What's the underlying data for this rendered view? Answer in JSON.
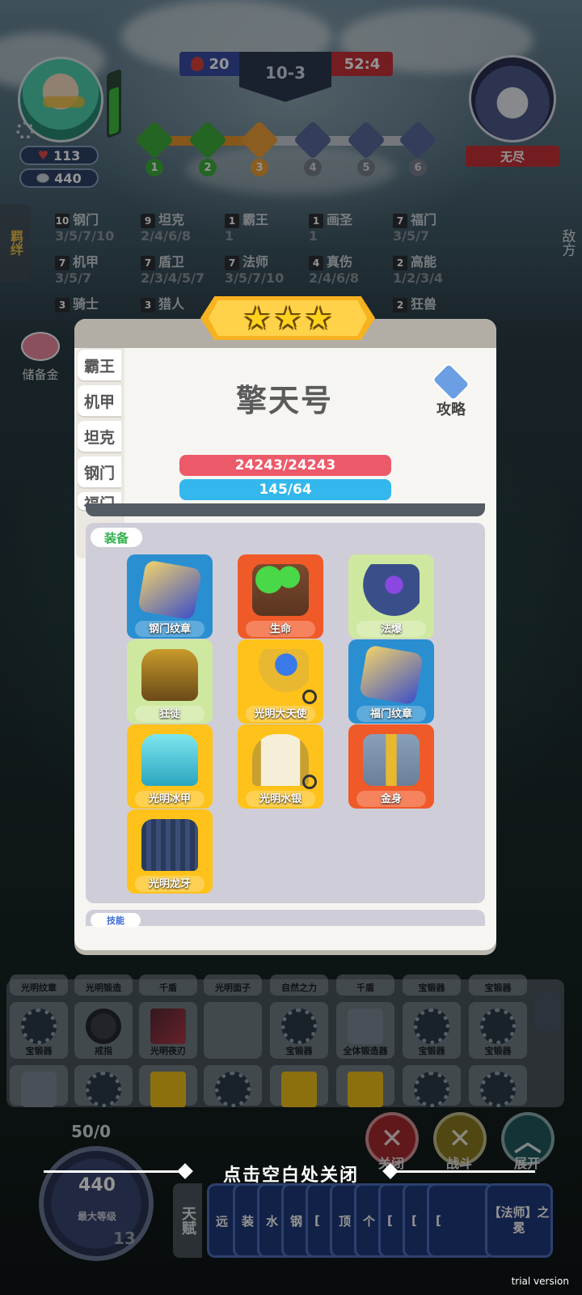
{
  "hud": {
    "player_hp": "113",
    "player_coins": "440",
    "score_left": "20",
    "stage": "10-3",
    "score_right": "52:4",
    "stage_nodes": [
      "1",
      "2",
      "3",
      "4",
      "5",
      "6"
    ],
    "mode_label": "无尽"
  },
  "side": {
    "left_tab": "羁绊",
    "right_tab": "敌方"
  },
  "synergies": [
    {
      "level": "10",
      "name": "钢门",
      "thresholds": "3/5/7/10"
    },
    {
      "level": "9",
      "name": "坦克",
      "thresholds": "2/4/6/8"
    },
    {
      "level": "1",
      "name": "霸王",
      "thresholds": "1"
    },
    {
      "level": "1",
      "name": "画圣",
      "thresholds": "1"
    },
    {
      "level": "7",
      "name": "福门",
      "thresholds": "3/5/7"
    },
    {
      "level": "7",
      "name": "机甲",
      "thresholds": "3/5/7"
    },
    {
      "level": "7",
      "name": "盾卫",
      "thresholds": "2/3/4/5/7"
    },
    {
      "level": "7",
      "name": "法师",
      "thresholds": "3/5/7/10"
    },
    {
      "level": "4",
      "name": "真伤",
      "thresholds": "2/4/6/8"
    },
    {
      "level": "2",
      "name": "高能",
      "thresholds": "1/2/3/4"
    },
    {
      "level": "3",
      "name": "骑士",
      "thresholds": ""
    },
    {
      "level": "3",
      "name": "猎人",
      "thresholds": ""
    },
    {
      "level": "2",
      "name": "狂兽",
      "thresholds": ""
    }
  ],
  "piggy": {
    "label": "储备金"
  },
  "modal": {
    "unit_name": "擎天号",
    "guide_label": "攻略",
    "hp": "24243/24243",
    "mp": "145/64",
    "tabs": [
      "霸王",
      "机甲",
      "坦克",
      "钢门",
      "福门"
    ],
    "equip_label": "装备",
    "skill_label": "技能",
    "equipment": [
      {
        "name": "钢门纹章",
        "color": "#2a8fd0"
      },
      {
        "name": "生命",
        "color": "#f05a28"
      },
      {
        "name": "法爆",
        "color": "#cfe8a0"
      },
      {
        "name": "狂徒",
        "color": "#cfe8a0"
      },
      {
        "name": "光明大天使",
        "color": "#ffc21a"
      },
      {
        "name": "福门纹章",
        "color": "#2a8fd0"
      },
      {
        "name": "光明冰甲",
        "color": "#ffc21a"
      },
      {
        "name": "光明水银",
        "color": "#ffc21a"
      },
      {
        "name": "金身",
        "color": "#f05a28"
      },
      {
        "name": "光明龙牙",
        "color": "#ffc21a"
      }
    ]
  },
  "bench": {
    "row1_labels": [
      "宝锻器",
      "戒指",
      "光明夜刃",
      "",
      "宝锻器",
      "全体锻造器",
      "宝锻器",
      "宝锻器"
    ],
    "row0_labels": [
      "光明纹章",
      "光明锻造",
      "千盾",
      "光明面子",
      "自然之力",
      "千盾",
      "宝锻器",
      "宝锻器"
    ]
  },
  "controls": {
    "close_label": "关闭",
    "fight_label": "战斗",
    "expand_label": "展开",
    "coin_count": "50/0",
    "coin_amount": "440",
    "coin_sub": "最大等级",
    "level": "13",
    "close_hint": "点击空白处关闭",
    "talent_tab": "天赋",
    "talent_cards": [
      "远",
      "装",
      "水",
      "钢",
      "[",
      "顶",
      "个",
      "[",
      "[",
      "[",
      "【法师】之冕"
    ]
  },
  "watermark": "trial version"
}
